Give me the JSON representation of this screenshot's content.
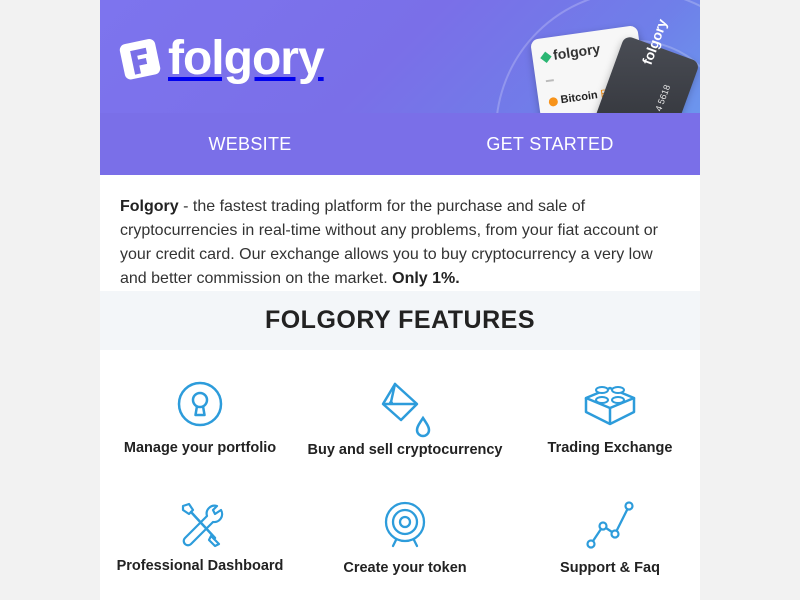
{
  "brand": {
    "name": "folgory"
  },
  "hero": {
    "card_brand": "folgory",
    "card_coin": "Bitcoin",
    "card_coin_ticker": "BTC",
    "dark_card_brand": "folgory",
    "dark_card_number": "4 5618"
  },
  "nav": {
    "website": "WEBSITE",
    "get_started": "GET STARTED"
  },
  "intro": {
    "brand": "Folgory",
    "text": " - the fastest trading platform for the purchase and sale of cryptocurrencies in real-time without any problems, from your fiat account or your credit card. Our exchange allows you to buy cryptocurrency a very low and better commission on the market. ",
    "emphasis": "Only 1%."
  },
  "features": {
    "title": "FOLGORY FEATURES",
    "items": [
      {
        "label": "Manage your portfolio",
        "icon": "keyhole-icon"
      },
      {
        "label": "Buy and sell cryptocurrency",
        "icon": "paint-bucket-icon"
      },
      {
        "label": "Trading Exchange",
        "icon": "lego-brick-icon"
      },
      {
        "label": "Professional Dashboard",
        "icon": "tools-icon"
      },
      {
        "label": "Create your token",
        "icon": "target-icon"
      },
      {
        "label": "Support & Faq",
        "icon": "line-chart-icon"
      }
    ]
  },
  "colors": {
    "primary": "#7a6fe8",
    "icon_blue": "#2d9cdb",
    "background": "#f2f2f2",
    "section_bg": "#f3f6f9"
  }
}
